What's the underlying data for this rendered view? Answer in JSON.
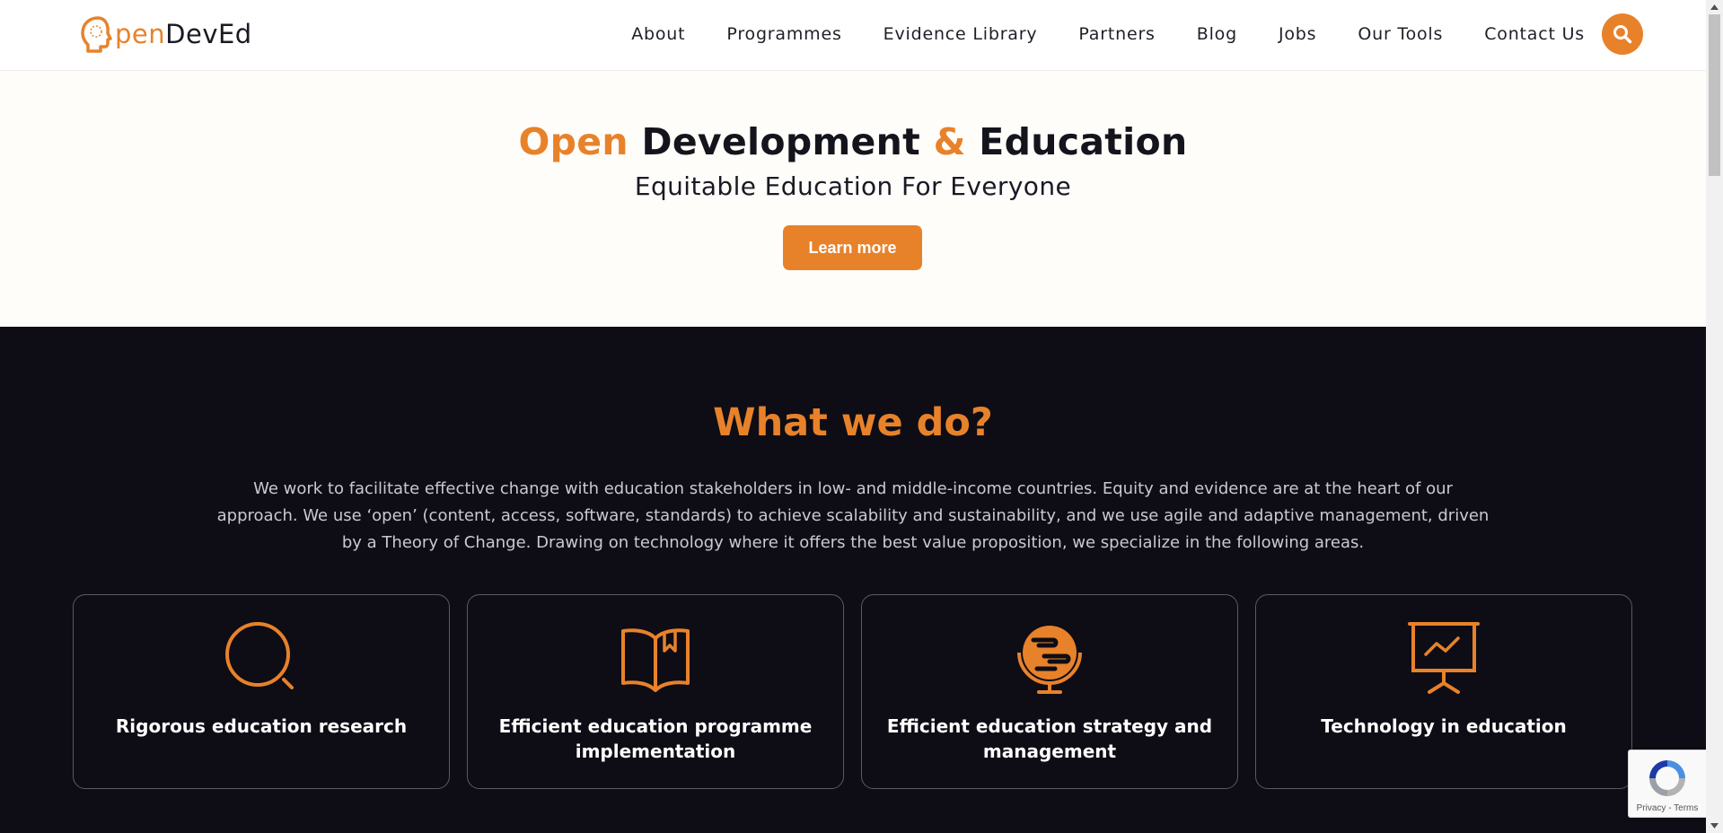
{
  "colors": {
    "accent": "#e8822a",
    "dark_bg": "#0e0d16",
    "hero_bg": "#fffdfa",
    "text_dark": "#14141c",
    "text_light": "#c9c9d2",
    "card_border": "#5a5a62"
  },
  "header": {
    "logo": {
      "part_accent": "pen",
      "part_dark": "DevEd",
      "icon": "head-logo-icon"
    },
    "nav": [
      {
        "label": "About"
      },
      {
        "label": "Programmes"
      },
      {
        "label": "Evidence Library"
      },
      {
        "label": "Partners"
      },
      {
        "label": "Blog"
      },
      {
        "label": "Jobs"
      },
      {
        "label": "Our Tools"
      },
      {
        "label": "Contact Us"
      }
    ],
    "search_icon": "search-icon"
  },
  "hero": {
    "title_part1": "Open",
    "title_part2": "Development",
    "title_amp": "&",
    "title_part3": "Education",
    "subtitle": "Equitable Education For Everyone",
    "button_label": "Learn more"
  },
  "what_we_do": {
    "title": "What we do?",
    "description": "We work to facilitate effective change with education stakeholders in low- and middle-income countries. Equity and evidence are at the heart of our approach. We use ‘open’ (content, access, software, standards) to achieve scalability and sustainability, and we use agile and adaptive management, driven by a Theory of Change. Drawing on technology where it offers the best value proposition, we specialize in the following areas.",
    "cards": [
      {
        "title": "Rigorous education research",
        "icon": "magnifier-icon"
      },
      {
        "title": "Efficient education programme implementation",
        "icon": "open-book-icon"
      },
      {
        "title": "Efficient education strategy and management",
        "icon": "globe-icon"
      },
      {
        "title": "Technology in education",
        "icon": "presentation-board-icon"
      }
    ]
  },
  "recaptcha": {
    "privacy": "Privacy",
    "separator": " - ",
    "terms": "Terms"
  }
}
